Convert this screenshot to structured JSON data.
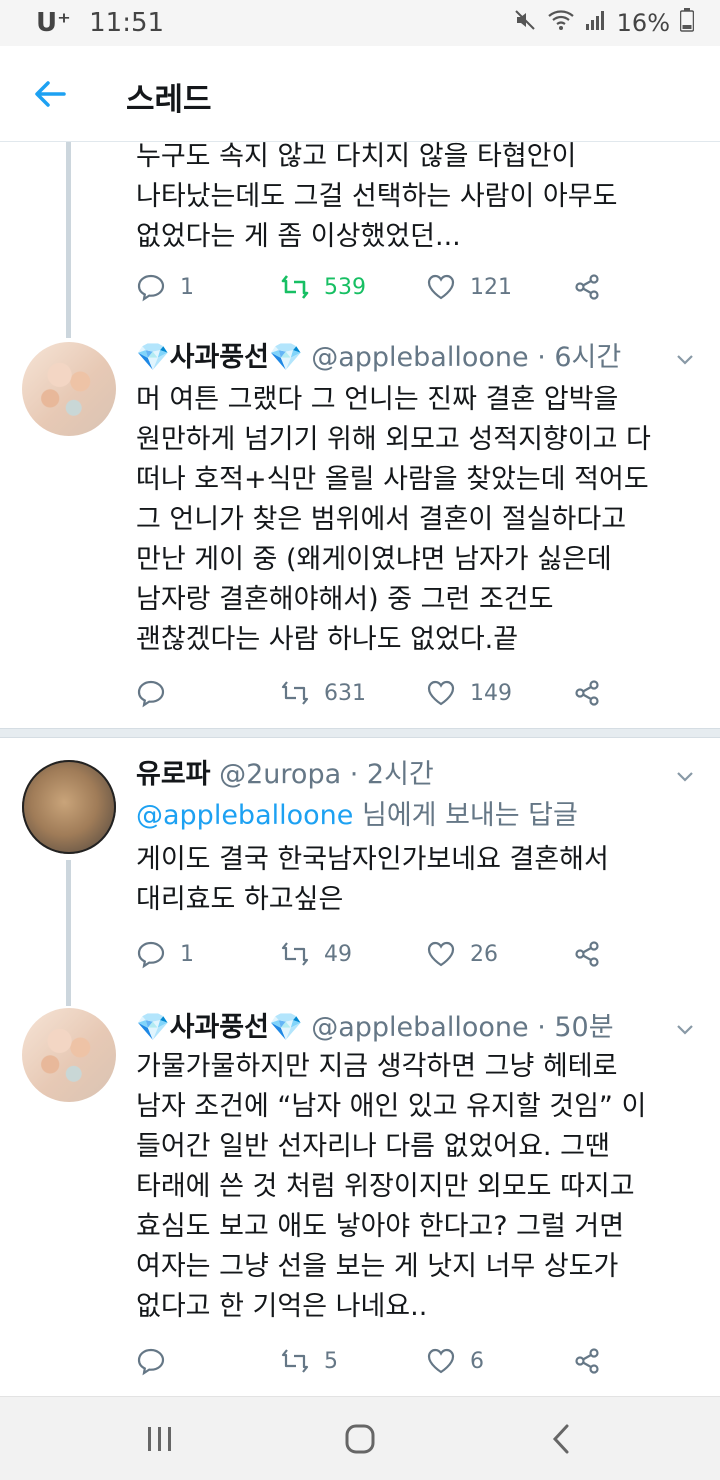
{
  "status_bar": {
    "carrier": "U⁺",
    "time": "11:51",
    "battery": "16%"
  },
  "app_bar": {
    "title": "스레드",
    "back_icon": "arrow-left-icon"
  },
  "colors": {
    "accent": "#1da1f2",
    "retweet_active": "#17bf63",
    "muted": "#657786"
  },
  "tweets": [
    {
      "text": "누구도 속지 않고 다치지 않을 타협안이\n나타났는데도 그걸 선택하는 사람이 아무도\n없었다는 게 좀 이상했었던...",
      "stats": {
        "replies": "1",
        "retweets": "539",
        "likes": "121"
      }
    },
    {
      "name": "사과풍선",
      "name_gem": "💎",
      "handle": "@appleballoone",
      "time": "· 6시간",
      "text": "머 여튼 그랬다 그 언니는 진짜 결혼 압박을\n원만하게 넘기기 위해 외모고 성적지향이고 다\n떠나 호적+식만 올릴 사람을 찾았는데 적어도\n그 언니가 찾은 범위에서 결혼이 절실하다고\n만난 게이 중 (왜게이였냐면 남자가 싫은데\n남자랑 결혼해야해서) 중 그런 조건도\n괜찮겠다는 사람 하나도 없었다.끝",
      "stats": {
        "replies": "",
        "retweets": "631",
        "likes": "149"
      }
    },
    {
      "name": "유로파",
      "handle": "@2uropa",
      "time": "· 2시간",
      "reply_mention": "@appleballoone",
      "reply_suffix": " 님에게 보내는 답글",
      "text": "게이도 결국 한국남자인가보네요 결혼해서\n대리효도 하고싶은",
      "stats": {
        "replies": "1",
        "retweets": "49",
        "likes": "26"
      }
    },
    {
      "name": "사과풍선",
      "name_gem": "💎",
      "handle": "@appleballoone",
      "time": "· 50분",
      "text": "가물가물하지만 지금 생각하면 그냥 헤테로\n남자 조건에 “남자 애인 있고 유지할 것임” 이\n들어간 일반 선자리나 다름 없었어요. 그땐\n타래에 쓴 것 처럼 위장이지만 외모도 따지고\n효심도 보고 애도 낳아야 한다고? 그럴 거면\n여자는 그냥 선을 보는 게 낫지 너무 상도가\n없다고 한 기억은 나네요..",
      "stats": {
        "replies": "",
        "retweets": "5",
        "likes": "6"
      }
    }
  ]
}
